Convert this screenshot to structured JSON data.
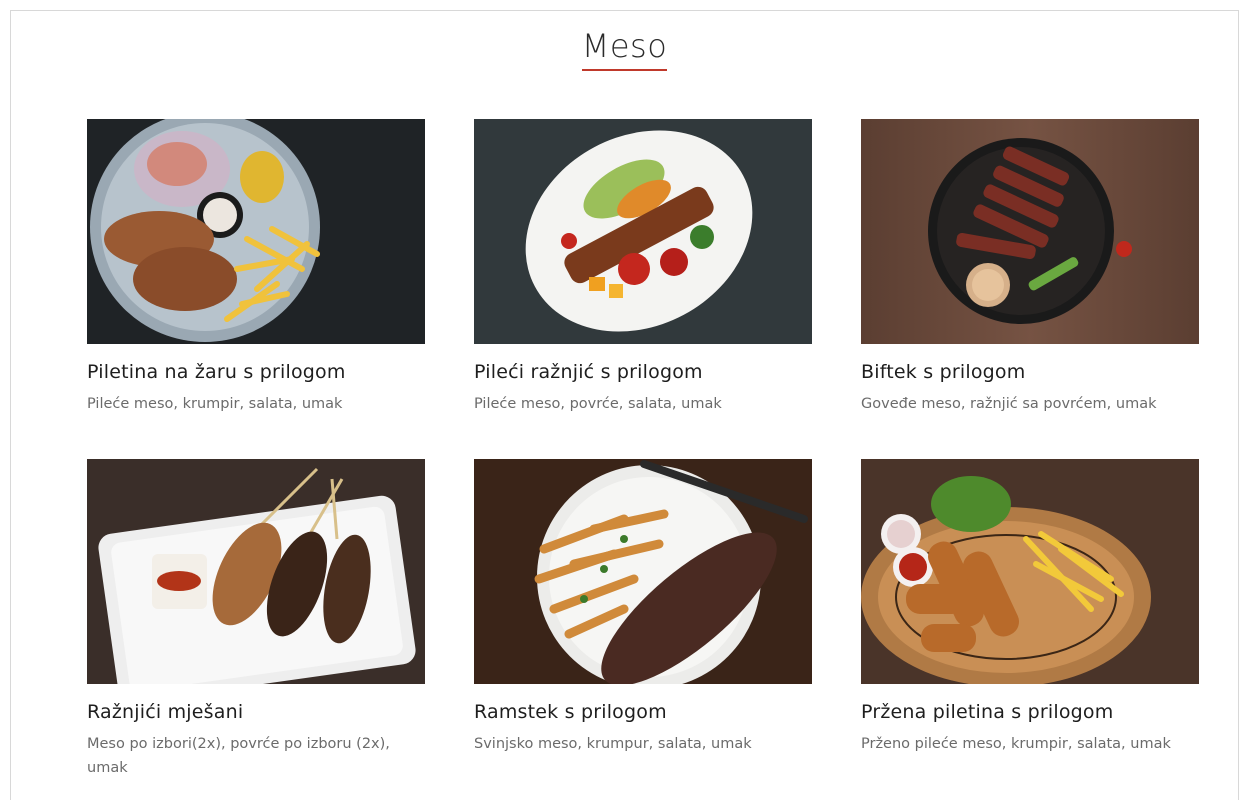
{
  "section": {
    "title": "Meso"
  },
  "items": [
    {
      "title": "Piletina na žaru s prilogom",
      "description": "Pileće meso, krumpir, salata, umak"
    },
    {
      "title": "Pileći ražnjić s prilogom",
      "description": "Pileće meso, povrće, salata, umak"
    },
    {
      "title": "Biftek s prilogom",
      "description": "Goveđe meso, ražnjić sa povrćem, umak"
    },
    {
      "title": "Ražnjići mješani",
      "description": "Meso po izbori(2x), povrće po izboru (2x), umak"
    },
    {
      "title": "Ramstek s prilogom",
      "description": "Svinjsko meso, krumpur, salata, umak"
    },
    {
      "title": "Pržena piletina s prilogom",
      "description": "Prženo pileće meso, krumpir, salata, umak"
    }
  ],
  "colors": {
    "accent": "#c0392b",
    "title_text": "#1e1e1e",
    "desc_text": "#6b6b6b"
  }
}
